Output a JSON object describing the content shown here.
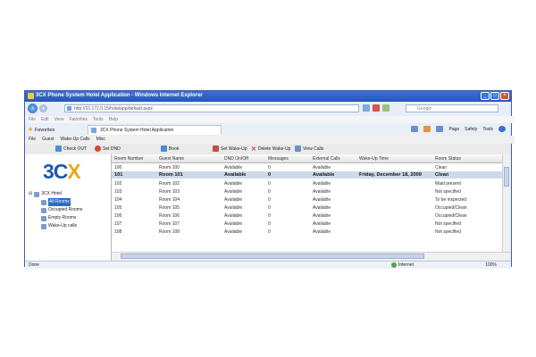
{
  "window": {
    "title": "3CX Phone System Hotel Application - Windows Internet Explorer",
    "address": "http://10.172.0.15/hotelapp/default.aspx",
    "search_placeholder": "Google",
    "menu": [
      "File",
      "Edit",
      "View",
      "Favorites",
      "Tools",
      "Help"
    ],
    "favorites_label": "Favorites",
    "tab_title": "3CX Phone System Hotel Application",
    "commands": [
      "Page",
      "Safety",
      "Tools"
    ]
  },
  "app": {
    "menu": [
      "File",
      "Guest",
      "Wake-Up Calls",
      "Misc"
    ],
    "toolbar": [
      "Check OUT",
      "Set DND",
      "Book",
      "Set Wake-Up",
      "Delete Wake-Up",
      "View Calls"
    ]
  },
  "logo": {
    "text_a": "3C",
    "text_b": "X"
  },
  "tree": {
    "root": "3CX Hotel",
    "items": [
      "All Rooms",
      "Occupied Rooms",
      "Empty Rooms",
      "Wake-Up calls"
    ]
  },
  "table": {
    "columns": [
      "Room Number",
      "Guest Name",
      "DND On/Off",
      "Messages",
      "External Calls",
      "Wake-Up Time",
      "Room Status"
    ],
    "rows": [
      [
        "100",
        "Room 100",
        "Available",
        "0",
        "Available",
        "",
        "Clean"
      ],
      [
        "101",
        "Room 101",
        "Available",
        "0",
        "Available",
        "Friday, December 18, 2009",
        "Clean"
      ],
      [
        "102",
        "Room 102",
        "Available",
        "0",
        "Available",
        "",
        "Maid present"
      ],
      [
        "103",
        "Room 103",
        "Available",
        "0",
        "Available",
        "",
        "Not specified"
      ],
      [
        "104",
        "Room 104",
        "Available",
        "0",
        "Available",
        "",
        "To be inspected"
      ],
      [
        "105",
        "Room 105",
        "Available",
        "0",
        "Available",
        "",
        "Occupied/Clean"
      ],
      [
        "106",
        "Room 106",
        "Available",
        "0",
        "Available",
        "",
        "Occupied/Clean"
      ],
      [
        "107",
        "Room 107",
        "Available",
        "0",
        "Available",
        "",
        "Not specified"
      ],
      [
        "108",
        "Room 108",
        "Available",
        "0",
        "Available",
        "",
        "Not specified"
      ]
    ],
    "selected_row": 1
  },
  "status": {
    "text": "Done",
    "zone": "Internet",
    "zoom": "100%"
  },
  "colors": {
    "accent": "#316ac5",
    "brand_blue": "#1d5aa7",
    "brand_orange": "#e7a91c"
  }
}
